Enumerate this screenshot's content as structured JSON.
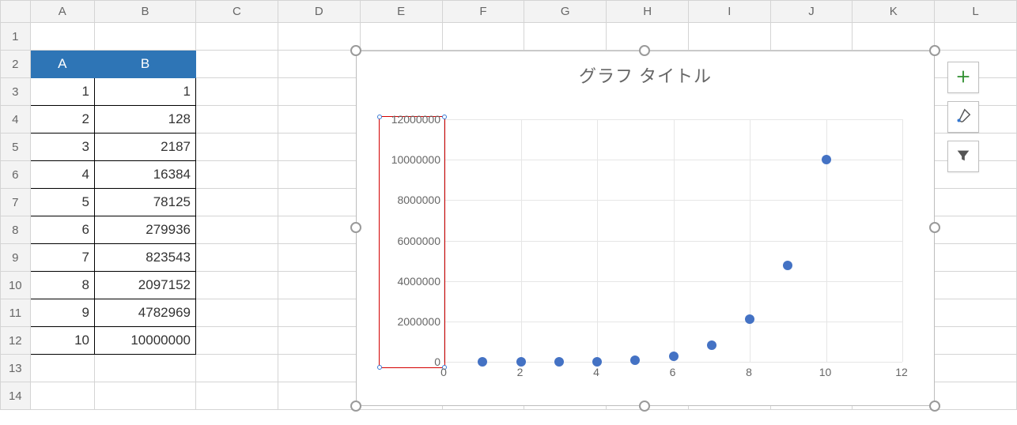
{
  "columns": [
    "A",
    "B",
    "C",
    "D",
    "E",
    "F",
    "G",
    "H",
    "I",
    "J",
    "K",
    "L"
  ],
  "rows": [
    "1",
    "2",
    "3",
    "4",
    "5",
    "6",
    "7",
    "8",
    "9",
    "10",
    "11",
    "12",
    "13",
    "14"
  ],
  "table": {
    "header": {
      "A": "A",
      "B": "B"
    },
    "rows": [
      {
        "A": "1",
        "B": "1"
      },
      {
        "A": "2",
        "B": "128"
      },
      {
        "A": "3",
        "B": "2187"
      },
      {
        "A": "4",
        "B": "16384"
      },
      {
        "A": "5",
        "B": "78125"
      },
      {
        "A": "6",
        "B": "279936"
      },
      {
        "A": "7",
        "B": "823543"
      },
      {
        "A": "8",
        "B": "2097152"
      },
      {
        "A": "9",
        "B": "4782969"
      },
      {
        "A": "10",
        "B": "10000000"
      }
    ]
  },
  "chart": {
    "title": "グラフ タイトル",
    "yticks": [
      "0",
      "2000000",
      "4000000",
      "6000000",
      "8000000",
      "10000000",
      "12000000"
    ],
    "xticks": [
      "0",
      "2",
      "4",
      "6",
      "8",
      "10",
      "12"
    ]
  },
  "chart_data": {
    "type": "scatter",
    "title": "グラフ タイトル",
    "xlabel": "",
    "ylabel": "",
    "xlim": [
      0,
      12
    ],
    "ylim": [
      0,
      12000000
    ],
    "series": [
      {
        "name": "B",
        "x": [
          1,
          2,
          3,
          4,
          5,
          6,
          7,
          8,
          9,
          10
        ],
        "y": [
          1,
          128,
          2187,
          16384,
          78125,
          279936,
          823543,
          2097152,
          4782969,
          10000000
        ]
      }
    ]
  },
  "side_buttons": {
    "add": "chart-elements-button",
    "style": "chart-styles-button",
    "filter": "chart-filter-button"
  },
  "colors": {
    "header_fill": "#2E75B6",
    "point_fill": "#4472C4",
    "axis_sel": "#d40000"
  }
}
